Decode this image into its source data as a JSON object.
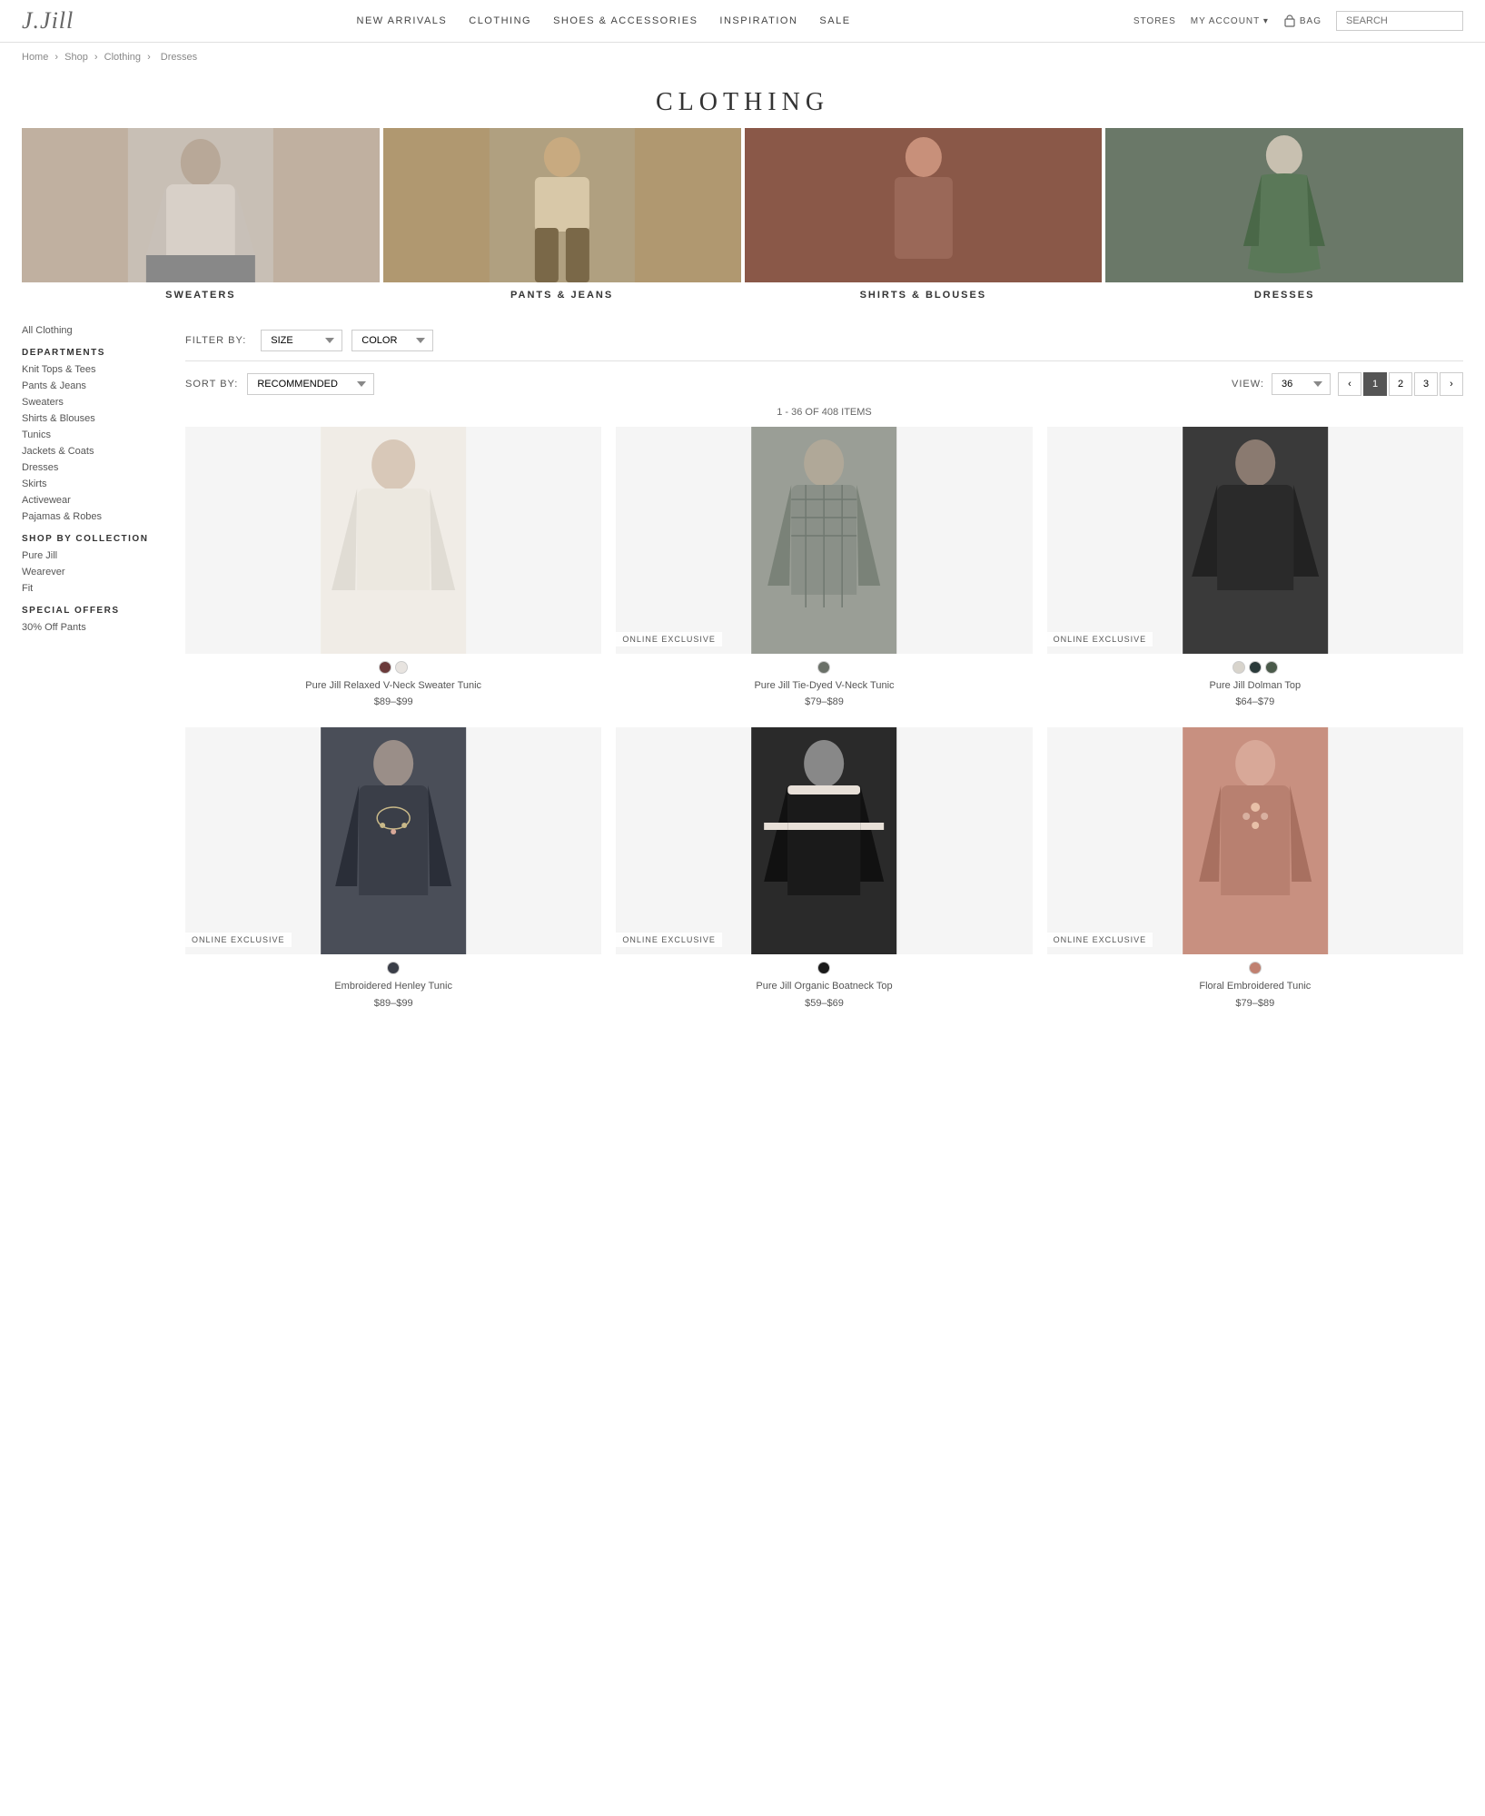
{
  "site": {
    "logo": "J.Jill",
    "nav_items": [
      "NEW ARRIVALS",
      "CLOTHING",
      "SHOES & ACCESSORIES",
      "INSPIRATION",
      "SALE"
    ],
    "header_links": [
      "STORES",
      "MY ACCOUNT ▾",
      "BAG"
    ],
    "search_placeholder": "SEARCH"
  },
  "breadcrumb": {
    "items": [
      "Home",
      "Shop",
      "Clothing",
      "Dresses"
    ],
    "separator": "›"
  },
  "page_title": "CLOTHING",
  "category_banners": [
    {
      "label": "SWEATERS",
      "color": "#c0b8ae"
    },
    {
      "label": "PANTS & JEANS",
      "color": "#b0a080"
    },
    {
      "label": "SHIRTS & BLOUSES",
      "color": "#8a5848"
    },
    {
      "label": "DRESSES",
      "color": "#6a7868"
    }
  ],
  "sidebar": {
    "all_clothing_label": "All Clothing",
    "departments_label": "DEPARTMENTS",
    "department_items": [
      "Knit Tops & Tees",
      "Pants & Jeans",
      "Sweaters",
      "Shirts & Blouses",
      "Tunics",
      "Jackets & Coats",
      "Dresses",
      "Skirts",
      "Activewear",
      "Pajamas & Robes"
    ],
    "shop_collection_label": "SHOP BY COLLECTION",
    "collection_items": [
      "Pure Jill",
      "Wearever",
      "Fit"
    ],
    "special_offers_label": "SPECIAL OFFERS",
    "special_offer_items": [
      "30% Off Pants"
    ]
  },
  "filters": {
    "label": "FILTER BY:",
    "size_label": "SIZE",
    "color_label": "COLOR",
    "sort_label": "SORT BY:",
    "sort_value": "RECOMMENDED",
    "view_label": "VIEW:",
    "view_value": "36",
    "items_count": "1 - 36 OF 408 ITEMS"
  },
  "pagination": {
    "current": 1,
    "pages": [
      1,
      2,
      3
    ],
    "prev": "‹",
    "next": "›"
  },
  "products": [
    {
      "name": "Pure Jill Relaxed V-Neck Sweater Tunic",
      "price": "$89–$99",
      "badge": "",
      "swatches": [
        "#6a3a3a",
        "#e8e4e0"
      ],
      "fig_class": "fig-sweater"
    },
    {
      "name": "Pure Jill Tie-Dyed V-Neck Tunic",
      "price": "$79–$89",
      "badge": "ONLINE EXCLUSIVE",
      "swatches": [
        "#6a7068"
      ],
      "fig_class": "fig-tiedye"
    },
    {
      "name": "Pure Jill Dolman Top",
      "price": "$64–$79",
      "badge": "ONLINE EXCLUSIVE",
      "swatches": [
        "#d8d4cc",
        "#2a3a3a",
        "#4a5a4a"
      ],
      "fig_class": "fig-dolman"
    },
    {
      "name": "Embroidered Henley Tunic",
      "price": "$89–$99",
      "badge": "ONLINE EXCLUSIVE",
      "swatches": [
        "#3a3e48"
      ],
      "fig_class": "fig-emb"
    },
    {
      "name": "Pure Jill Organic Boatneck Top",
      "price": "$59–$69",
      "badge": "ONLINE EXCLUSIVE",
      "swatches": [
        "#1a1a1a"
      ],
      "fig_class": "fig-boat"
    },
    {
      "name": "Floral Embroidered Tunic",
      "price": "$79–$89",
      "badge": "ONLINE EXCLUSIVE",
      "swatches": [
        "#c08070"
      ],
      "fig_class": "fig-pink"
    }
  ]
}
